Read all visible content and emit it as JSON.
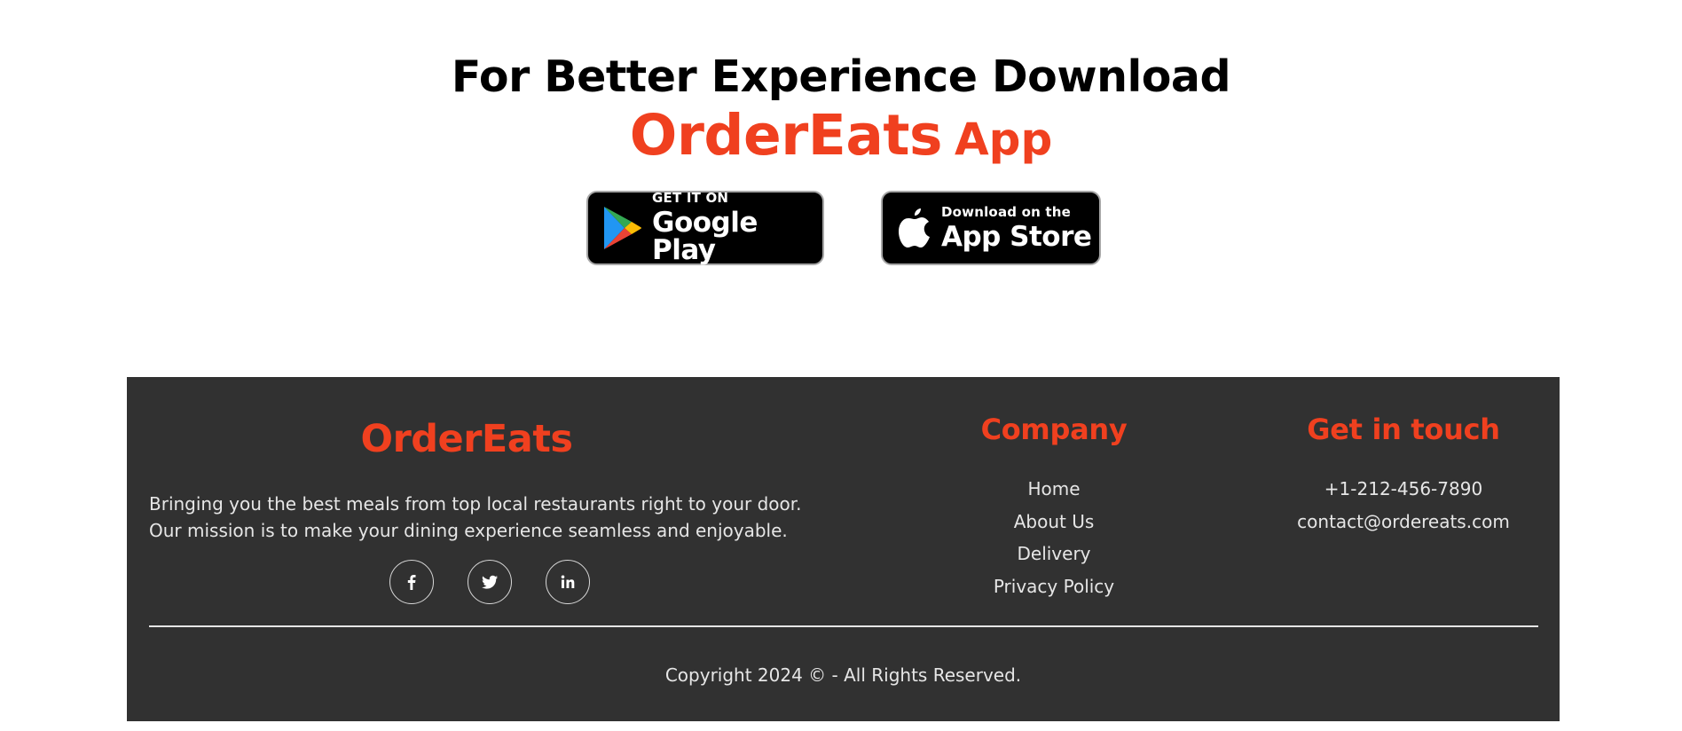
{
  "download": {
    "headline": "For Better Experience Download",
    "brand_name": "OrderEats",
    "brand_suffix": "App",
    "google_play": {
      "small": "GET IT ON",
      "large": "Google Play",
      "icon": "google-play-icon"
    },
    "app_store": {
      "small": "Download on the",
      "large": "App Store",
      "icon": "apple-icon"
    }
  },
  "footer": {
    "brand": "OrderEats",
    "mission": "Bringing you the best meals from top local restaurants right to your door. Our mission is to make your dining experience seamless and enjoyable.",
    "social": [
      {
        "icon": "facebook-icon"
      },
      {
        "icon": "twitter-icon"
      },
      {
        "icon": "linkedin-icon"
      }
    ],
    "company": {
      "heading": "Company",
      "links": [
        "Home",
        "About Us",
        "Delivery",
        "Privacy Policy"
      ]
    },
    "contact": {
      "heading": "Get in touch",
      "phone": "+1-212-456-7890",
      "email": "contact@ordereats.com"
    },
    "copyright": "Copyright 2024 © - All Rights Reserved."
  },
  "colors": {
    "accent": "#f0401f",
    "footer_bg": "#313131",
    "footer_text": "#e6e6e6"
  }
}
